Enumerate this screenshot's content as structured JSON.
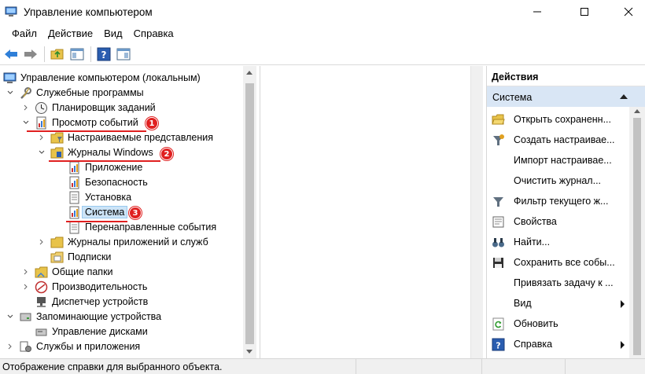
{
  "window": {
    "title": "Управление компьютером",
    "minimize_glyph": "—",
    "maximize_glyph": "☐",
    "close_glyph": "✕"
  },
  "menu": [
    {
      "label": "Файл"
    },
    {
      "label": "Действие"
    },
    {
      "label": "Вид"
    },
    {
      "label": "Справка"
    }
  ],
  "tree": {
    "root": "Управление компьютером (локальным)",
    "service_programs": "Служебные программы",
    "task_scheduler": "Планировщик заданий",
    "event_viewer": "Просмотр событий",
    "custom_views": "Настраиваемые представления",
    "windows_logs": "Журналы Windows",
    "application": "Приложение",
    "security": "Безопасность",
    "setup": "Установка",
    "system": "Система",
    "forwarded_events": "Перенаправленные события",
    "app_service_logs": "Журналы приложений и служб",
    "subscriptions": "Подписки",
    "shared_folders": "Общие папки",
    "performance": "Производительность",
    "device_manager": "Диспетчер устройств",
    "storage": "Запоминающие устройства",
    "disk_management": "Управление дисками",
    "services_apps": "Службы и приложения"
  },
  "badges": {
    "b1": "1",
    "b2": "2",
    "b3": "3"
  },
  "actions": {
    "header": "Действия",
    "group": "Система",
    "items": [
      {
        "label": "Открыть сохраненн...",
        "icon": "open-folder-icon"
      },
      {
        "label": "Создать настраивае...",
        "icon": "filter-create-icon"
      },
      {
        "label": "Импорт настраивае...",
        "icon": ""
      },
      {
        "label": "Очистить журнал...",
        "icon": ""
      },
      {
        "label": "Фильтр текущего ж...",
        "icon": "filter-icon"
      },
      {
        "label": "Свойства",
        "icon": "properties-icon"
      },
      {
        "label": "Найти...",
        "icon": "binoculars-icon"
      },
      {
        "label": "Сохранить все собы...",
        "icon": "save-icon"
      },
      {
        "label": "Привязать задачу к ...",
        "icon": ""
      },
      {
        "label": "Вид",
        "icon": "",
        "submenu": true
      },
      {
        "label": "Обновить",
        "icon": "refresh-icon"
      },
      {
        "label": "Справка",
        "icon": "help-icon",
        "submenu": true
      }
    ]
  },
  "status": {
    "text": "Отображение справки для выбранного объекта."
  },
  "colors": {
    "selection": "#cce4f7",
    "actions_group_bg": "#d9e6f5",
    "annotation_red": "#e02020"
  }
}
